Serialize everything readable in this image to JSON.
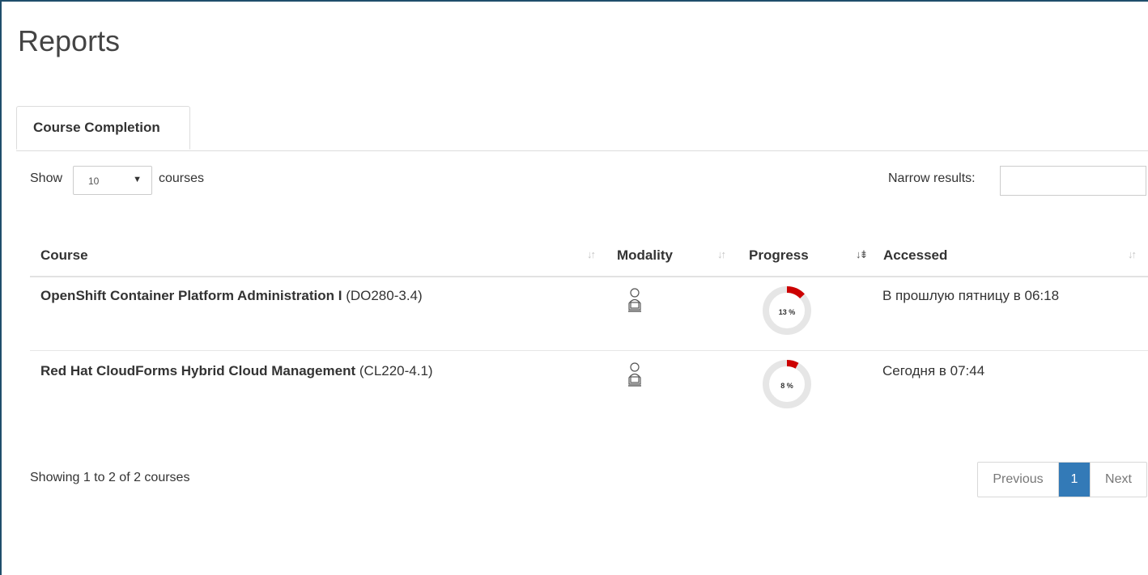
{
  "page": {
    "title": "Reports"
  },
  "tabs": [
    {
      "label": "Course Completion"
    }
  ],
  "controls": {
    "show_label": "Show",
    "page_size": "10",
    "show_suffix": "courses",
    "narrow_label": "Narrow results:",
    "narrow_value": ""
  },
  "table": {
    "columns": [
      {
        "label": "Course"
      },
      {
        "label": "Modality"
      },
      {
        "label": "Progress"
      },
      {
        "label": "Accessed"
      }
    ],
    "sort_icons": {
      "unsorted": "↓↑",
      "sorted": "↓⇟"
    },
    "rows": [
      {
        "title": "OpenShift Container Platform Administration I",
        "code": "(DO280-3.4)",
        "modality_icon": "classroom-student-icon",
        "progress": 13,
        "progress_label": "13 %",
        "accessed": "В прошлую пятницу в 06:18"
      },
      {
        "title": "Red Hat CloudForms Hybrid Cloud Management",
        "code": "(CL220-4.1)",
        "modality_icon": "classroom-student-icon",
        "progress": 8,
        "progress_label": "8 %",
        "accessed": "Сегодня в 07:44"
      }
    ]
  },
  "footer": {
    "info": "Showing 1 to 2 of 2 courses",
    "previous": "Previous",
    "current_page": "1",
    "next": "Next"
  },
  "colors": {
    "progress_fill": "#cc0000",
    "progress_track": "#e6e6e6",
    "pager_active": "#337ab7"
  }
}
